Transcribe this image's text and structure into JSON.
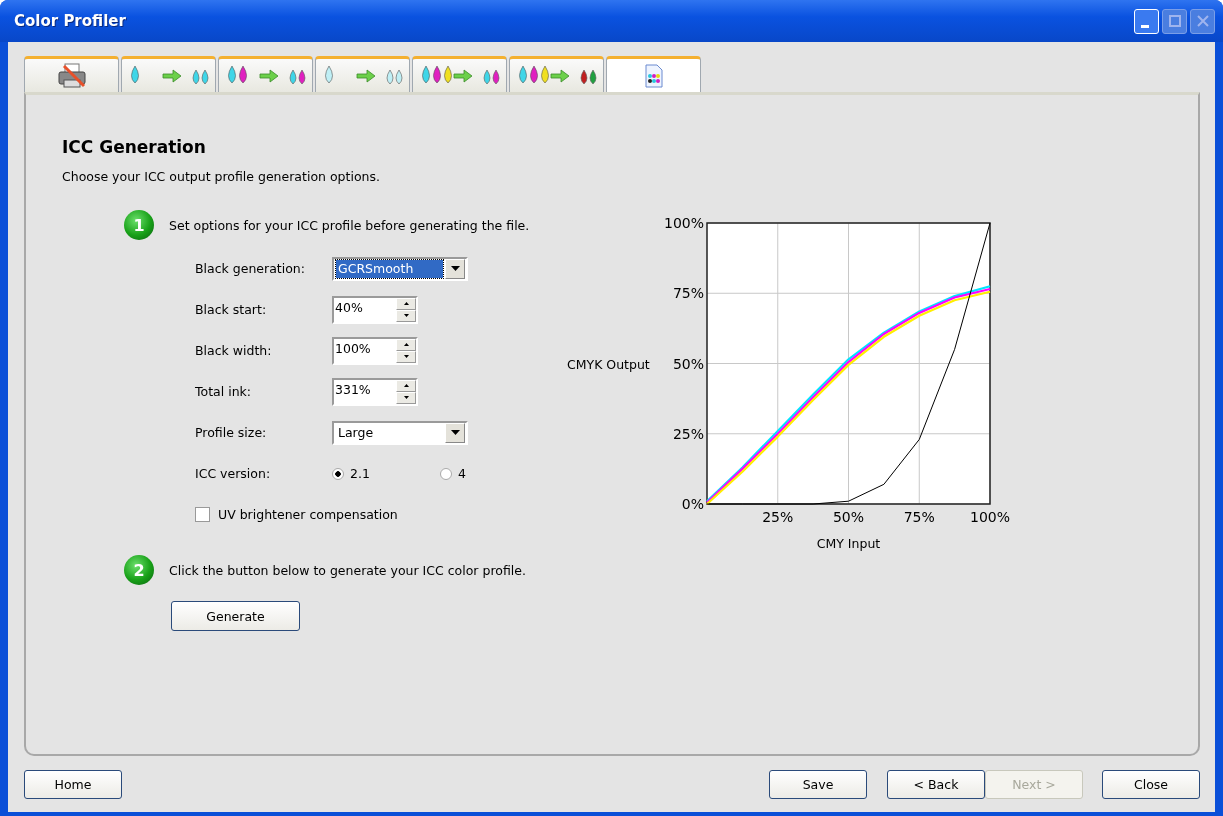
{
  "window": {
    "title": "Color Profiler"
  },
  "tabs": [
    {
      "selected": false
    },
    {
      "selected": false
    },
    {
      "selected": false
    },
    {
      "selected": false
    },
    {
      "selected": false
    },
    {
      "selected": false
    },
    {
      "selected": true
    }
  ],
  "heading": "ICC Generation",
  "description": "Choose your ICC output profile generation options.",
  "step1": {
    "number": "1",
    "text": "Set options for your ICC profile before generating the file."
  },
  "options": [
    {
      "kind": "dropdown",
      "label": "Black generation:",
      "value": "GCRSmooth",
      "focused": true
    },
    {
      "kind": "spinner",
      "label": "Black start:",
      "value": "40%"
    },
    {
      "kind": "spinner",
      "label": "Black width:",
      "value": "100%"
    },
    {
      "kind": "spinner",
      "label": "Total ink:",
      "value": "331%"
    },
    {
      "kind": "dropdown",
      "label": "Profile size:",
      "value": "Large",
      "focused": false
    },
    {
      "kind": "radio",
      "label": "ICC version:",
      "choices": [
        {
          "label": "2.1",
          "selected": true
        },
        {
          "label": "4",
          "selected": false
        }
      ]
    },
    {
      "kind": "checkbox",
      "label": "UV brightener compensation",
      "checked": false
    }
  ],
  "step2": {
    "number": "2",
    "text": "Click the button below to generate your ICC color profile."
  },
  "generate_button": "Generate",
  "chart": {
    "chart_data": {
      "type": "line",
      "xlabel": "CMY Input",
      "ylabel": "CMYK Output",
      "x": [
        0,
        12.5,
        25,
        37.5,
        50,
        62.5,
        75,
        87.5,
        100
      ],
      "xlim": [
        0,
        100
      ],
      "ylim": [
        0,
        100
      ],
      "grid": true,
      "xticks": [
        {
          "value": 25,
          "label": "25%"
        },
        {
          "value": 50,
          "label": "50%"
        },
        {
          "value": 75,
          "label": "75%"
        },
        {
          "value": 100,
          "label": "100%"
        }
      ],
      "yticks": [
        {
          "value": 0,
          "label": "0%"
        },
        {
          "value": 25,
          "label": "25%"
        },
        {
          "value": 50,
          "label": "50%"
        },
        {
          "value": 75,
          "label": "75%"
        },
        {
          "value": 100,
          "label": "100%"
        }
      ],
      "series": [
        {
          "color": "#00e5ff",
          "values": [
            1,
            13,
            26,
            39,
            51.5,
            61,
            68.5,
            74,
            77.5
          ]
        },
        {
          "color": "#ff00ff",
          "values": [
            0.5,
            12.5,
            25,
            38,
            50.5,
            60.5,
            68,
            73.5,
            76.5
          ]
        },
        {
          "color": "#ffee00",
          "values": [
            0,
            11.5,
            24,
            37,
            49.5,
            59.5,
            67,
            72.5,
            75.5
          ]
        },
        {
          "color": "#000000",
          "values": [
            0,
            0,
            0,
            0,
            1,
            7,
            23,
            55,
            100
          ]
        }
      ]
    }
  },
  "footer": {
    "left": [
      {
        "label": "Home",
        "disabled": false
      }
    ],
    "right": [
      {
        "label": "Save",
        "disabled": false
      },
      {
        "label": "< Back",
        "disabled": false
      },
      {
        "label": "Next >",
        "disabled": true
      },
      {
        "label": "Close",
        "disabled": false
      }
    ]
  }
}
